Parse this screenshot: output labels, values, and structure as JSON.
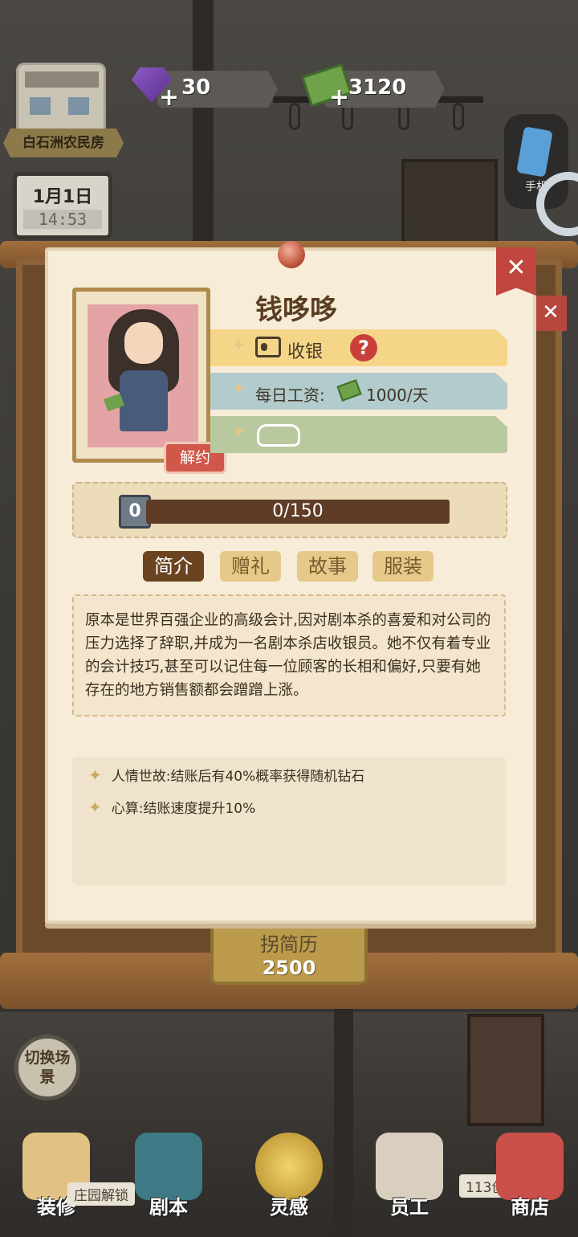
{
  "hud": {
    "gems": "30",
    "cash": "3120",
    "location": "白石洲农民房",
    "date": "1月1日",
    "time": "14:53",
    "phone_label": "手机"
  },
  "background": {
    "renovate_title": "拐简历",
    "renovate_cost": "2500",
    "switch_scene": "切换场景",
    "unlock_tip": "庄园解锁",
    "play_tip": "113创"
  },
  "dialog": {
    "name": "钱哆哆",
    "job": "收银",
    "wage_label": "每日工资:",
    "wage_value": "1000/天",
    "terminate": "解约",
    "close": "✕",
    "level": "0",
    "exp": "0/150",
    "tabs": [
      {
        "label": "简介",
        "active": true
      },
      {
        "label": "赠礼",
        "active": false
      },
      {
        "label": "故事",
        "active": false
      },
      {
        "label": "服装",
        "active": false
      }
    ],
    "description": "原本是世界百强企业的高级会计,因对剧本杀的喜爱和对公司的压力选择了辞职,并成为一名剧本杀店收银员。她不仅有着专业的会计技巧,甚至可以记住每一位顾客的长相和偏好,只要有她存在的地方销售额都会蹭蹭上涨。",
    "skills": [
      "人情世故:结账后有40%概率获得随机钻石",
      "心算:结账速度提升10%"
    ]
  },
  "nav": [
    {
      "label": "装修",
      "icon": "house-icon"
    },
    {
      "label": "剧本",
      "icon": "book-icon"
    },
    {
      "label": "灵感",
      "icon": "bulb-icon"
    },
    {
      "label": "员工",
      "icon": "staff-card-icon"
    },
    {
      "label": "商店",
      "icon": "shop-icon"
    }
  ],
  "colors": {
    "accent": "#6a4320",
    "close_red": "#c0463f",
    "paper": "#f6ecd8",
    "job_tag": "#f5d688",
    "wage_tag": "#b2cbcc",
    "skill_tag": "#b9c99f"
  }
}
